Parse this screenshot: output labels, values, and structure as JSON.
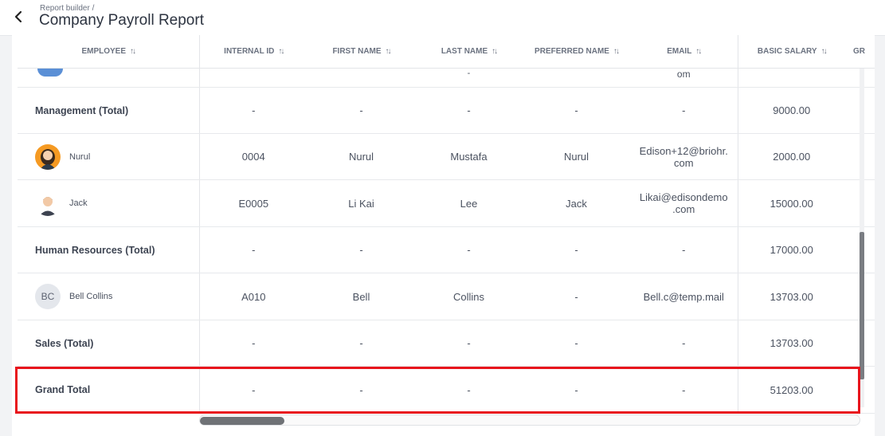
{
  "header": {
    "breadcrumb": "Report builder /",
    "title": "Company Payroll Report"
  },
  "table": {
    "columns": {
      "employee": "EMPLOYEE",
      "internal_id": "INTERNAL ID",
      "first_name": "FIRST NAME",
      "last_name": "LAST NAME",
      "preferred_name": "PREFERRED NAME",
      "email": "EMAIL",
      "basic_salary": "BASIC SALARY",
      "next": "GR"
    },
    "partial_row": {
      "last_name": "-",
      "email": "om"
    },
    "rows": [
      {
        "employee": "Management (Total)",
        "internal_id": "-",
        "first_name": "-",
        "last_name": "-",
        "preferred_name": "-",
        "email": "-",
        "basic_salary": "9000.00"
      },
      {
        "employee": "Nurul",
        "internal_id": "0004",
        "first_name": "Nurul",
        "last_name": "Mustafa",
        "preferred_name": "Nurul",
        "email_1": "Edison+12@briohr.",
        "email_2": "com",
        "basic_salary": "2000.00"
      },
      {
        "employee": "Jack",
        "internal_id": "E0005",
        "first_name": "Li Kai",
        "last_name": "Lee",
        "preferred_name": "Jack",
        "email_1": "Likai@edisondemo",
        "email_2": ".com",
        "basic_salary": "15000.00"
      },
      {
        "employee": "Human Resources (Total)",
        "internal_id": "-",
        "first_name": "-",
        "last_name": "-",
        "preferred_name": "-",
        "email": "-",
        "basic_salary": "17000.00"
      },
      {
        "employee": "Bell Collins",
        "initials": "BC",
        "internal_id": "A010",
        "first_name": "Bell",
        "last_name": "Collins",
        "preferred_name": "-",
        "email": "Bell.c@temp.mail",
        "basic_salary": "13703.00"
      },
      {
        "employee": "Sales (Total)",
        "internal_id": "-",
        "first_name": "-",
        "last_name": "-",
        "preferred_name": "-",
        "email": "-",
        "basic_salary": "13703.00"
      },
      {
        "employee": "Grand Total",
        "internal_id": "-",
        "first_name": "-",
        "last_name": "-",
        "preferred_name": "-",
        "email": "-",
        "basic_salary": "51203.00"
      }
    ]
  },
  "colors": {
    "highlight": "#e8141c",
    "scroll_thumb": "#6f7276"
  },
  "icons": {
    "back": "chevron-left-icon",
    "sort": "sort-icon"
  }
}
